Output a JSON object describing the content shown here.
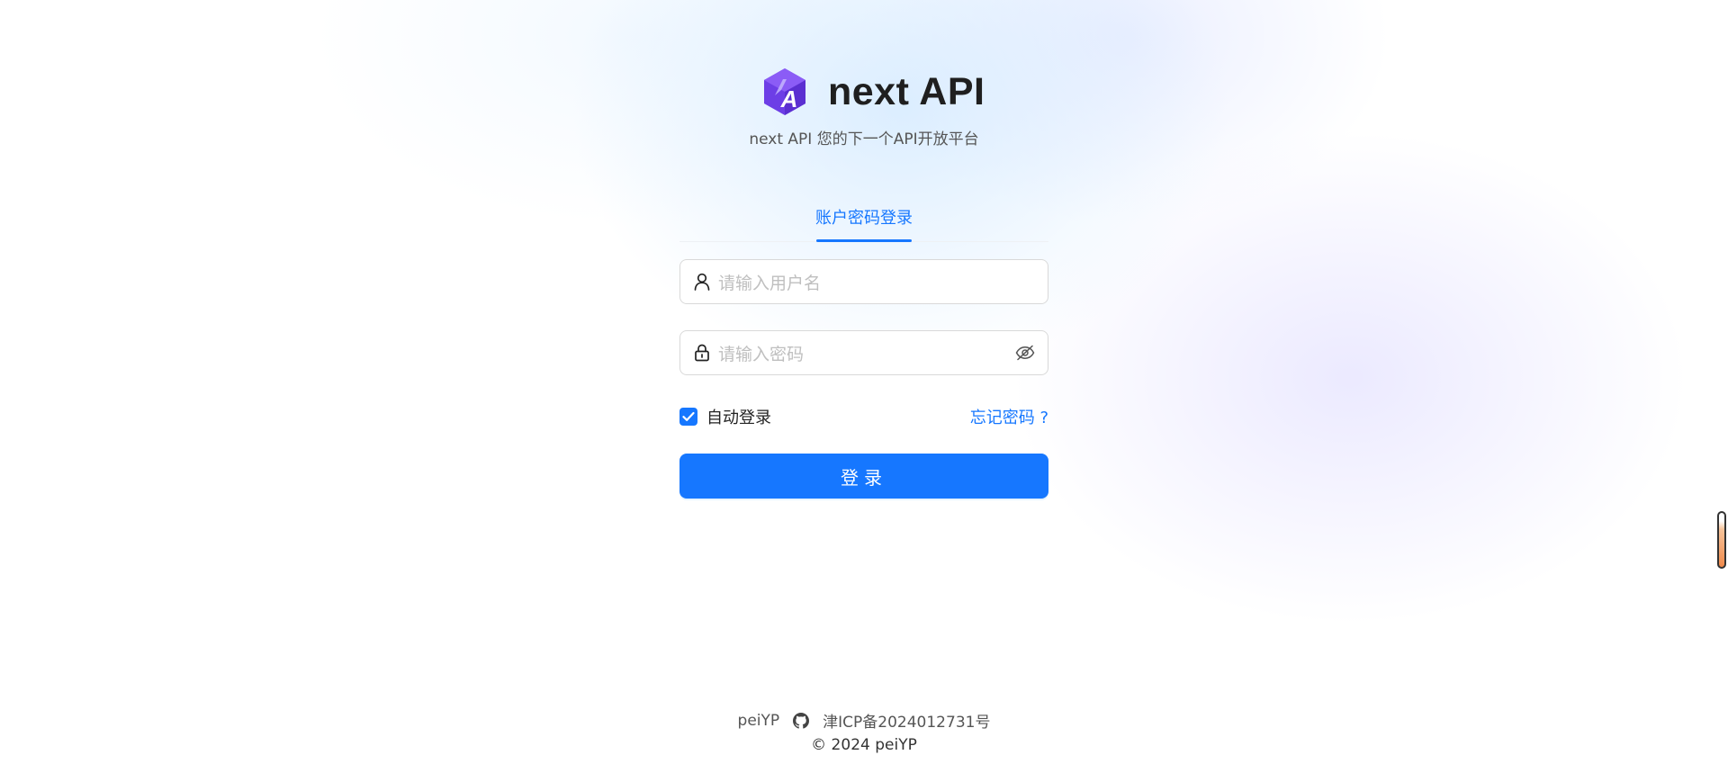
{
  "app": {
    "title": "next API",
    "subtitle": "next API 您的下一个API开放平台"
  },
  "tabs": [
    {
      "label": "账户密码登录",
      "active": true
    }
  ],
  "form": {
    "username": {
      "placeholder": "请输入用户名",
      "value": ""
    },
    "password": {
      "placeholder": "请输入密码",
      "value": ""
    },
    "remember": {
      "label": "自动登录",
      "checked": true
    },
    "forgot_label": "忘记密码 ?",
    "submit_label": "登录"
  },
  "footer": {
    "author": "peiYP",
    "icp": "津ICP备2024012731号",
    "copyright": "© 2024 peiYP"
  },
  "icons": {
    "logo": "hexagon-a-logo",
    "user": "user-icon",
    "lock": "lock-icon",
    "eye": "eye-invisible-icon",
    "github": "github-icon"
  },
  "colors": {
    "primary": "#1677ff",
    "logo_purple": "#7c3aed"
  }
}
